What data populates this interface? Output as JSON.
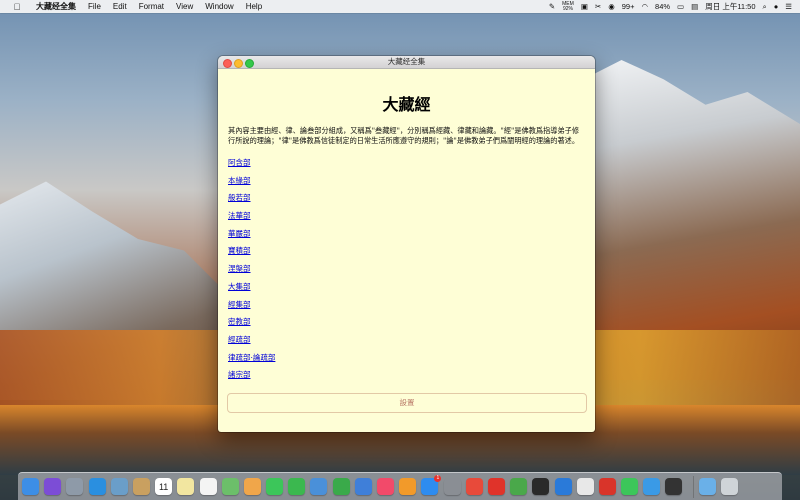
{
  "menubar": {
    "apple_icon": "apple-icon",
    "app_name": "大藏经全集",
    "items": [
      "File",
      "Edit",
      "Format",
      "View",
      "Window",
      "Help"
    ],
    "status": {
      "mem_label": "MEM",
      "mem_value": "92%",
      "badge_count": "99+",
      "battery": "84%",
      "datetime": "周日 上午11:50"
    }
  },
  "window": {
    "title": "大藏经全集",
    "document": {
      "heading": "大藏經",
      "intro": "其內容主要由經、律、論叁部分組成，又稱爲\"叁藏經\"，分別稱爲經藏、律藏和論藏。\"經\"是佛教爲指導弟子修行所說的理論；\"律\"是佛教爲信徒制定的日常生活所應遵守的規則；\"論\"是佛教弟子們爲闡明經的理論的著述。",
      "sections": [
        "阿含部",
        "本緣部",
        "般若部",
        "法華部",
        "華嚴部",
        "寶積部",
        "涅槃部",
        "大集部",
        "經集部",
        "密教部",
        "經疏部",
        "律疏部·論疏部",
        "諸宗部"
      ]
    },
    "settings_button": "設置"
  },
  "dock": {
    "calendar_day": "11",
    "app_store_badge": "1",
    "icons": [
      {
        "name": "finder-icon",
        "color": "#3d8ee6"
      },
      {
        "name": "siri-icon",
        "color": "#7c4dd6"
      },
      {
        "name": "launchpad-icon",
        "color": "#8e9aa8"
      },
      {
        "name": "safari-icon",
        "color": "#2a8fe0"
      },
      {
        "name": "preview-icon",
        "color": "#6a9ec9"
      },
      {
        "name": "notes-app-icon",
        "color": "#c9a060"
      },
      {
        "name": "calendar-icon",
        "color": "#ffffff"
      },
      {
        "name": "stickies-icon",
        "color": "#f2e6a0"
      },
      {
        "name": "reminders-icon",
        "color": "#f4f4f4"
      },
      {
        "name": "maps-icon",
        "color": "#6cbf6a"
      },
      {
        "name": "photos-icon",
        "color": "#f0a64a"
      },
      {
        "name": "messages-icon",
        "color": "#3cc65a"
      },
      {
        "name": "facetime-icon",
        "color": "#3bb84f"
      },
      {
        "name": "keynote-preview-icon",
        "color": "#4a90d9"
      },
      {
        "name": "numbers-icon",
        "color": "#3aaa4a"
      },
      {
        "name": "keynote-icon",
        "color": "#3f7fd9"
      },
      {
        "name": "music-icon",
        "color": "#f24a6a"
      },
      {
        "name": "books-icon",
        "color": "#f29a2a"
      },
      {
        "name": "app-store-icon",
        "color": "#2e8cf0"
      },
      {
        "name": "system-preferences-icon",
        "color": "#8a8e94"
      },
      {
        "name": "chrome-icon",
        "color": "#e84a3a"
      },
      {
        "name": "red-app-icon",
        "color": "#e0332a"
      },
      {
        "name": "green-app-icon",
        "color": "#4aa84a"
      },
      {
        "name": "terminal-icon",
        "color": "#2a2a2a"
      },
      {
        "name": "blue-app-icon",
        "color": "#2a7ad9"
      },
      {
        "name": "text-edit-icon",
        "color": "#e8e8e8"
      },
      {
        "name": "netease-music-icon",
        "color": "#d9342a"
      },
      {
        "name": "wechat-icon",
        "color": "#3cc65a"
      },
      {
        "name": "finder-alt-icon",
        "color": "#3a9ae6"
      },
      {
        "name": "dark-app-icon",
        "color": "#333333"
      },
      {
        "name": "downloads-folder-icon",
        "color": "#6ab0e8"
      },
      {
        "name": "trash-icon",
        "color": "#cfd4d8"
      }
    ]
  }
}
